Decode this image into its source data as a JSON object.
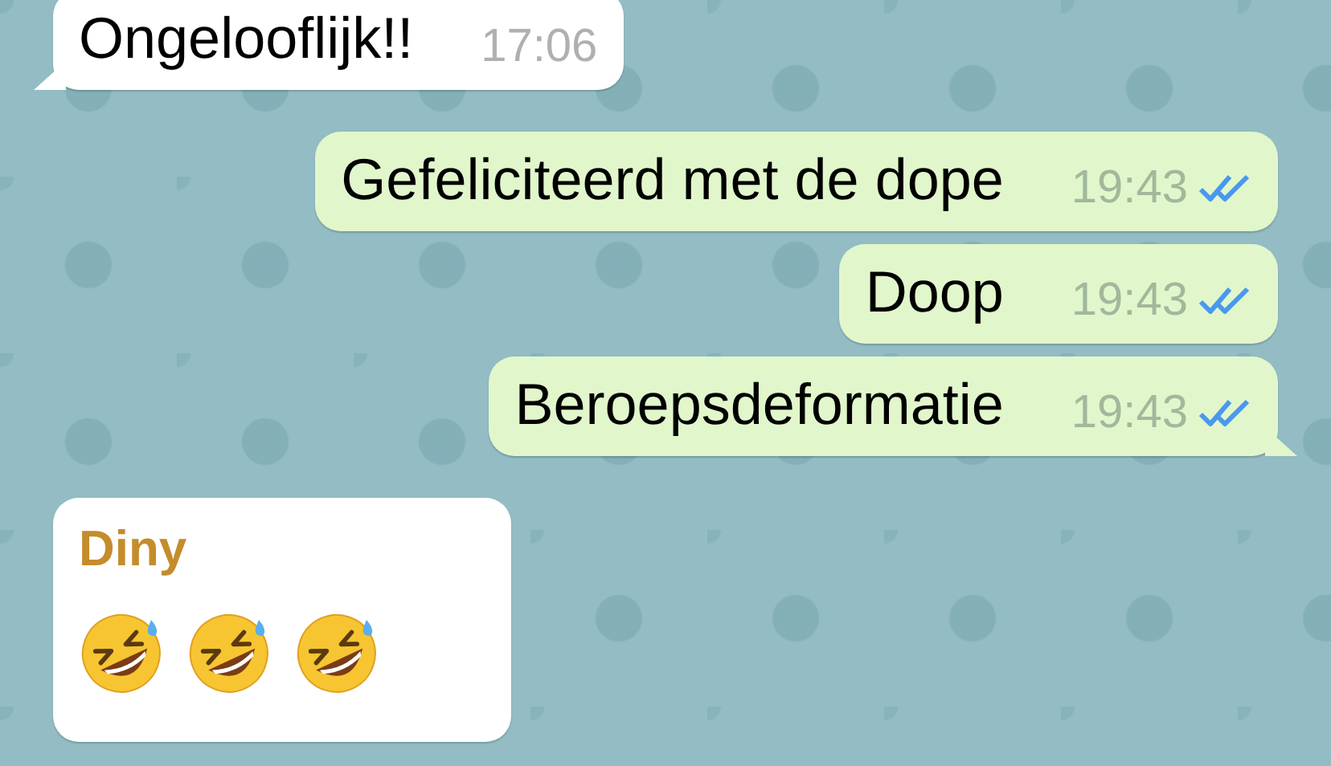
{
  "messages": [
    {
      "outgoing": false,
      "text": "Ongelooflijk!!",
      "time": "17:06",
      "tail": true
    },
    {
      "outgoing": true,
      "text": "Gefeliciteerd met de dope",
      "time": "19:43",
      "read": true,
      "tail": false
    },
    {
      "outgoing": true,
      "text": "Doop",
      "time": "19:43",
      "read": true,
      "tail": false
    },
    {
      "outgoing": true,
      "text": "Beroepsdeformatie",
      "time": "19:43",
      "read": true,
      "tail": true
    },
    {
      "outgoing": false,
      "sender": "Diny",
      "emojis": [
        {
          "kind": "rolling-laughing"
        },
        {
          "kind": "rolling-laughing"
        },
        {
          "kind": "rolling-laughing"
        }
      ],
      "tail": false
    }
  ]
}
